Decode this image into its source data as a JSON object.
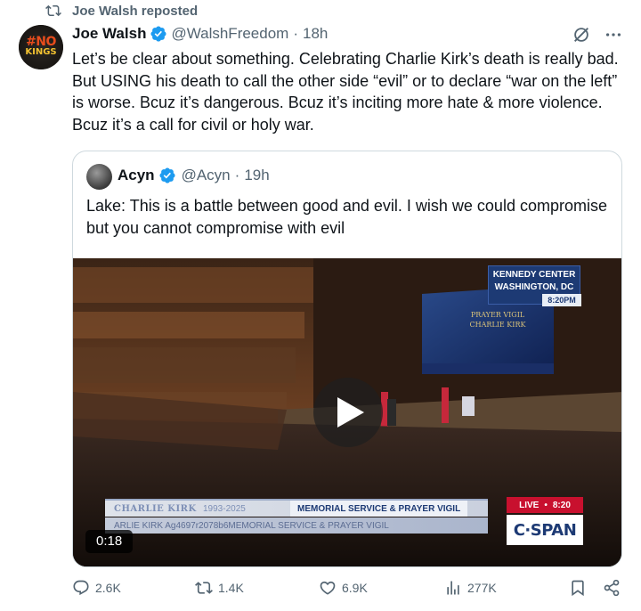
{
  "repost": {
    "label": "Joe Walsh reposted",
    "icon": "repost-icon"
  },
  "tweet": {
    "author_name": "Joe Walsh",
    "handle": "@WalshFreedom",
    "separator": "·",
    "time": "18h",
    "avatar_text_line1": "#NO",
    "avatar_text_line2": "KINGS",
    "text": "Let’s be clear about something. Celebrating Charlie Kirk’s death is really bad. But USING his death to call the other side “evil” or to declare “war on the left” is worse. Bcuz it’s dangerous. Bcuz it’s inciting more hate & more violence. Bcuz it’s a call for civil or holy war."
  },
  "quote": {
    "author_name": "Acyn",
    "handle": "@Acyn",
    "separator": "·",
    "time": "19h",
    "text": "Lake: This is a battle between good and evil. I wish we could compromise but you cannot compromise with evil",
    "video": {
      "location_line1": "KENNEDY CENTER",
      "location_line2": "WASHINGTON, DC",
      "location_time": "8:20PM",
      "screen_line1": "PRAYER VIGIL",
      "screen_line2": "CHARLIE KIRK",
      "lower_name": "CHARLIE KIRK",
      "lower_years": "1993-2025",
      "lower_event": "MEMORIAL SERVICE & PRAYER VIGIL",
      "lower_ticker": "ARLIE KIRK  Ag4697r2078b6MEMORIAL SERVICE & PRAYER VIGIL",
      "live_label": "LIVE",
      "live_time": "8:20",
      "network": "C·SPAN",
      "duration": "0:18"
    }
  },
  "actions": {
    "replies": "2.6K",
    "reposts": "1.4K",
    "likes": "6.9K",
    "views": "277K"
  },
  "colors": {
    "verified": "#1d9bf0",
    "muted": "#536471",
    "border": "#cfd9de"
  }
}
